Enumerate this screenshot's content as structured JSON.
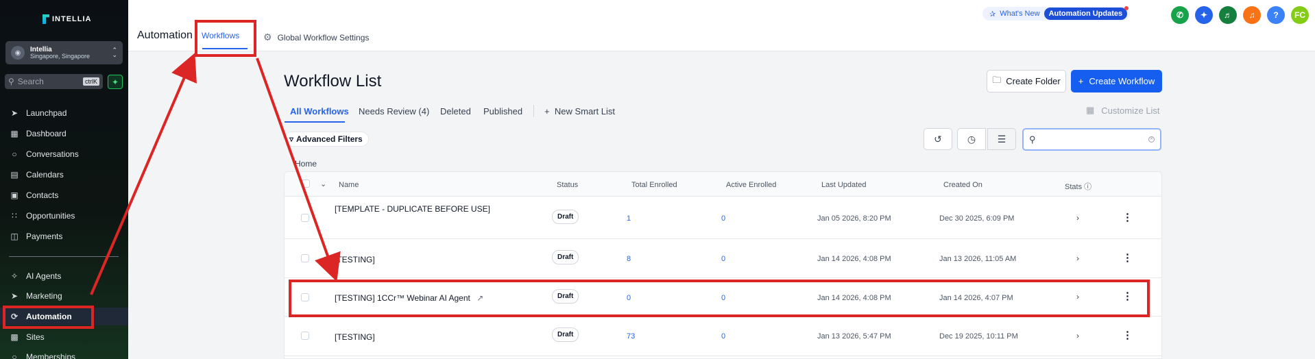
{
  "sidebar": {
    "logo_text": "INTELLIA",
    "location": {
      "name": "Intellia",
      "sub": "Singapore, Singapore"
    },
    "search": {
      "placeholder": "Search",
      "shortcut": "ctrlK"
    },
    "items": [
      {
        "label": "Launchpad",
        "icon": "rocket-icon"
      },
      {
        "label": "Dashboard",
        "icon": "grid-icon"
      },
      {
        "label": "Conversations",
        "icon": "chat-icon"
      },
      {
        "label": "Calendars",
        "icon": "calendar-icon"
      },
      {
        "label": "Contacts",
        "icon": "contacts-icon"
      },
      {
        "label": "Opportunities",
        "icon": "opportunities-icon"
      },
      {
        "label": "Payments",
        "icon": "payments-icon"
      },
      {
        "label": "AI Agents",
        "icon": "sparkle-icon"
      },
      {
        "label": "Marketing",
        "icon": "send-icon"
      },
      {
        "label": "Automation",
        "icon": "automation-icon",
        "active": true
      },
      {
        "label": "Sites",
        "icon": "sites-icon"
      },
      {
        "label": "Memberships",
        "icon": "memberships-icon"
      }
    ]
  },
  "topbar": {
    "title": "Automation",
    "tabs": {
      "workflows": "Workflows",
      "settings": "Global Workflow Settings"
    },
    "whats_new": "What's New",
    "updates": "Automation Updates",
    "avatar_initials": "FC",
    "help_label": "?"
  },
  "main": {
    "title": "Workflow List",
    "create_folder": "Create Folder",
    "create_workflow": "Create Workflow",
    "tabs": [
      "All Workflows",
      "Needs Review (4)",
      "Deleted",
      "Published"
    ],
    "new_smart_list": "New Smart List",
    "customize_list": "Customize List",
    "advanced_filters": "Advanced Filters",
    "breadcrumb": "Home"
  },
  "table": {
    "columns": [
      "Name",
      "Status",
      "Total Enrolled",
      "Active Enrolled",
      "Last Updated",
      "Created On",
      "Stats"
    ],
    "rows": [
      {
        "name": "[TEMPLATE - DUPLICATE BEFORE USE]",
        "status": "Draft",
        "total": "1",
        "active": "0",
        "updated": "Jan 05 2026, 8:20 PM",
        "created": "Dec 30 2025, 6:09 PM"
      },
      {
        "name": "[TESTING]",
        "status": "Draft",
        "total": "8",
        "active": "0",
        "updated": "Jan 14 2026, 4:08 PM",
        "created": "Jan 13 2026, 11:05 AM"
      },
      {
        "name": "[TESTING] 1CCr™ Webinar AI Agent",
        "status": "Draft",
        "total": "0",
        "active": "0",
        "updated": "Jan 14 2026, 4:08 PM",
        "created": "Jan 14 2026, 4:07 PM"
      },
      {
        "name": "[TESTING]",
        "status": "Draft",
        "total": "73",
        "active": "0",
        "updated": "Jan 13 2026, 5:47 PM",
        "created": "Dec 19 2025, 10:11 PM"
      }
    ]
  },
  "colors": {
    "accent": "#155eef",
    "highlight": "#dc2626"
  }
}
